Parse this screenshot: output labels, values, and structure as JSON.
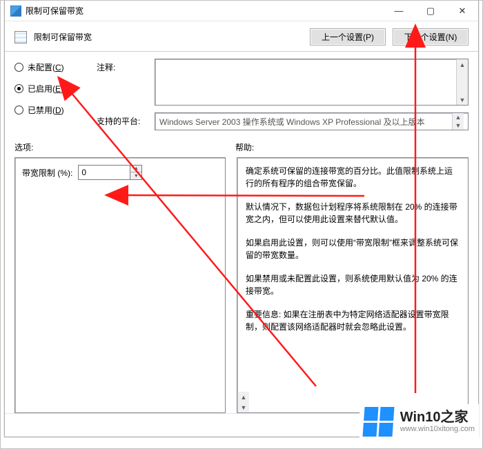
{
  "window": {
    "title": "限制可保留带宽"
  },
  "toolbar": {
    "title": "限制可保留带宽",
    "prev": "上一个设置(P)",
    "next": "下一个设置(N)"
  },
  "radios": {
    "not_configured": "未配置(C)",
    "enabled": "已启用(E)",
    "disabled": "已禁用(D)",
    "selected": "enabled"
  },
  "labels": {
    "comment": "注释:",
    "platform": "支持的平台:",
    "options": "选项:",
    "help": "帮助:"
  },
  "platform_text": "Windows Server 2003 操作系统或 Windows XP Professional 及以上版本",
  "options": {
    "bw_label": "带宽限制 (%):",
    "bw_value": "0"
  },
  "help": {
    "p1": "确定系统可保留的连接带宽的百分比。此值限制系统上运行的所有程序的组合带宽保留。",
    "p2": "默认情况下，数据包计划程序将系统限制在 20% 的连接带宽之内，但可以使用此设置来替代默认值。",
    "p3": "如果启用此设置，则可以使用“带宽限制”框来调整系统可保留的带宽数量。",
    "p4": "如果禁用或未配置此设置，则系统使用默认值为 20% 的连接带宽。",
    "p5": "重要信息: 如果在注册表中为特定网络适配器设置带宽限制，则配置该网络适配器时就会忽略此设置。"
  },
  "watermark": {
    "brand": "Win10之家",
    "url": "www.win10xitong.com"
  }
}
